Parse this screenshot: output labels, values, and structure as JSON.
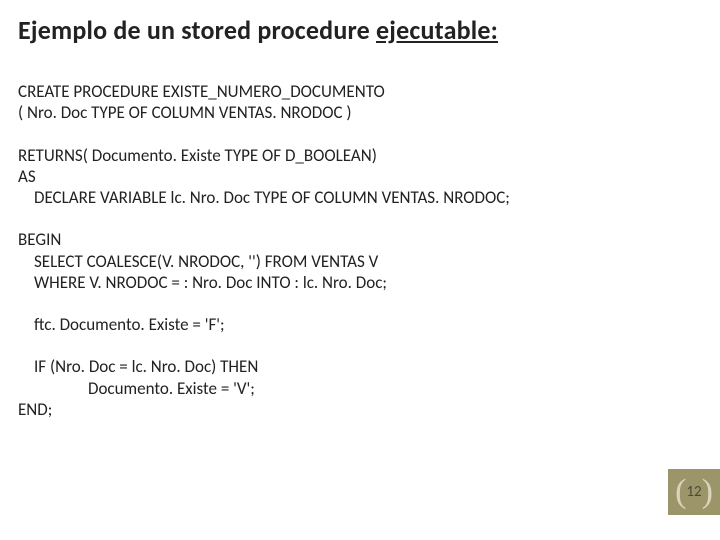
{
  "title": {
    "prefix": "Ejemplo de un stored procedure ",
    "underlined": "ejecutable:"
  },
  "code": {
    "p1_l1": "CREATE PROCEDURE EXISTE_NUMERO_DOCUMENTO",
    "p1_l2": "( Nro. Doc TYPE OF COLUMN VENTAS. NRODOC )",
    "p2_l1": "RETURNS( Documento. Existe TYPE OF D_BOOLEAN)",
    "p2_l2": "AS",
    "p2_l3": "DECLARE VARIABLE lc. Nro. Doc TYPE OF COLUMN VENTAS. NRODOC;",
    "p3_l1": "BEGIN",
    "p3_l2": "SELECT  COALESCE(V. NRODOC, '')   FROM   VENTAS V",
    "p3_l3": "WHERE      V. NRODOC  = : Nro. Doc   INTO   : lc. Nro. Doc;",
    "p4_l1": "ftc. Documento. Existe = 'F';",
    "p5_l1": "IF (Nro. Doc = lc. Nro. Doc) THEN",
    "p5_l2": "Documento. Existe = 'V';",
    "p5_l3": "END;"
  },
  "page_number": "12"
}
